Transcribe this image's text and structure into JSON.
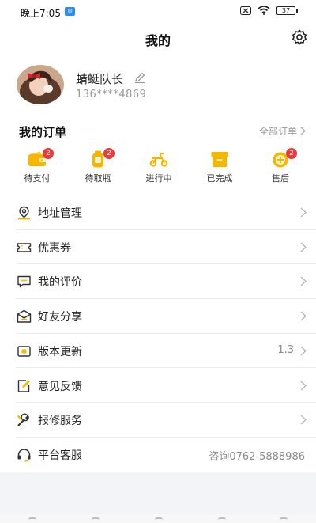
{
  "status_bar": {
    "time": "晚上7:05",
    "battery": "37"
  },
  "header": {
    "title": "我的"
  },
  "profile": {
    "username": "蜻蜓队长",
    "phone": "136****4869"
  },
  "orders": {
    "title": "我的订单",
    "all_label": "全部订单",
    "items": [
      {
        "label": "待支付",
        "badge": "2",
        "icon": "wallet-icon"
      },
      {
        "label": "待取瓶",
        "badge": "2",
        "icon": "bottle-icon"
      },
      {
        "label": "进行中",
        "badge": "",
        "icon": "scooter-icon"
      },
      {
        "label": "已完成",
        "badge": "",
        "icon": "box-icon"
      },
      {
        "label": "售后",
        "badge": "2",
        "icon": "after-sales-icon"
      }
    ]
  },
  "menu": [
    {
      "label": "地址管理",
      "value": "",
      "icon": "location-icon"
    },
    {
      "label": "优惠券",
      "value": "",
      "icon": "coupon-icon"
    },
    {
      "label": "我的评价",
      "value": "",
      "icon": "comment-icon"
    },
    {
      "label": "好友分享",
      "value": "",
      "icon": "share-icon"
    },
    {
      "label": "版本更新",
      "value": "1.3",
      "icon": "update-icon"
    },
    {
      "label": "意见反馈",
      "value": "",
      "icon": "feedback-icon"
    },
    {
      "label": "报修服务",
      "value": "",
      "icon": "wrench-icon"
    },
    {
      "label": "平台客服",
      "value": "咨询0762-5888986",
      "icon": "headset-icon"
    }
  ],
  "colors": {
    "accent_yellow": "#f6b600",
    "badge_red": "#e83b3b"
  }
}
